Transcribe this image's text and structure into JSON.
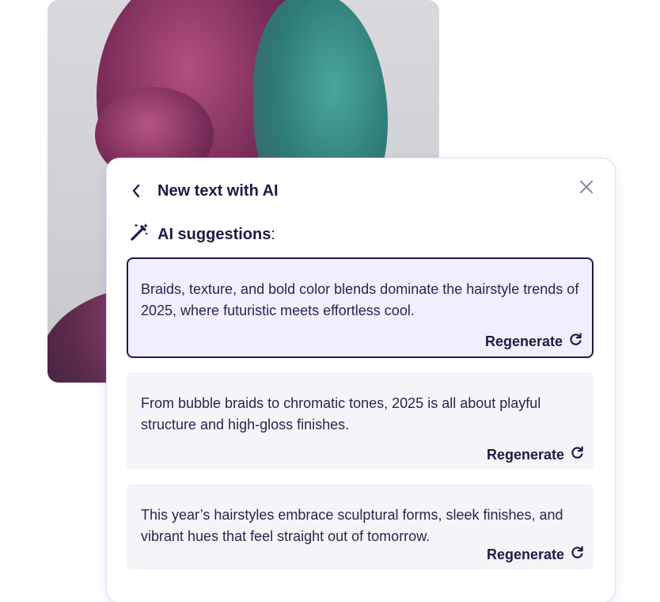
{
  "panel": {
    "title": "New text with AI",
    "suggestions_label": "AI suggestions",
    "suggestions_colon": ":"
  },
  "suggestions": [
    {
      "text": "Braids, texture, and bold color blends dominate the hairstyle trends of 2025, where futuristic meets effortless cool.",
      "regenerate_label": "Regenerate",
      "selected": true
    },
    {
      "text": "From bubble braids to chromatic tones, 2025 is all about playful structure and high-gloss finishes.",
      "regenerate_label": "Regenerate",
      "selected": false
    },
    {
      "text": "This year’s hairstyles embrace sculptural forms, sleek finishes, and vibrant hues that feel straight out of tomorrow.",
      "regenerate_label": "Regenerate",
      "selected": false
    }
  ],
  "icons": {
    "back": "chevron-left-icon",
    "close": "close-icon",
    "magic": "magic-wand-icon",
    "regenerate": "refresh-icon"
  },
  "colors": {
    "text_dark": "#1f1a45",
    "selected_bg": "#f3eefd",
    "card_bg": "#f5f4f8",
    "close_gray": "#8a88a0"
  }
}
